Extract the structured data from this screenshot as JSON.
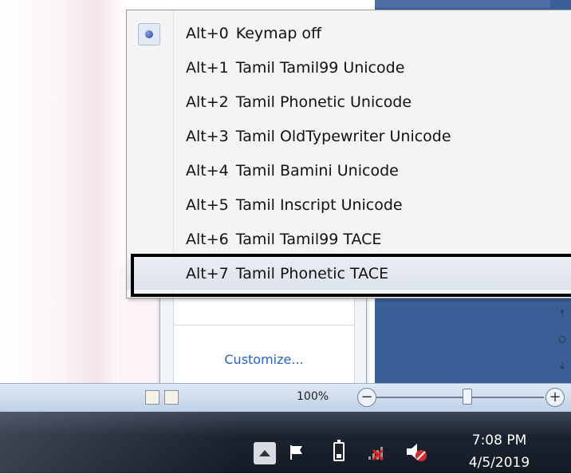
{
  "menu": {
    "items": [
      {
        "hotkey": "Alt+0",
        "label": "Keymap off",
        "checked": true
      },
      {
        "hotkey": "Alt+1",
        "label": "Tamil Tamil99 Unicode",
        "checked": false
      },
      {
        "hotkey": "Alt+2",
        "label": "Tamil Phonetic Unicode",
        "checked": false
      },
      {
        "hotkey": "Alt+3",
        "label": "Tamil OldTypewriter Unicode",
        "checked": false
      },
      {
        "hotkey": "Alt+4",
        "label": "Tamil Bamini Unicode",
        "checked": false
      },
      {
        "hotkey": "Alt+5",
        "label": "Tamil Inscript Unicode",
        "checked": false
      },
      {
        "hotkey": "Alt+6",
        "label": "Tamil Tamil99 TACE",
        "checked": false
      },
      {
        "hotkey": "Alt+7",
        "label": "Tamil Phonetic TACE",
        "checked": false
      }
    ],
    "highlighted_index": 7
  },
  "tray_popup": {
    "customize_label": "Customize..."
  },
  "statusbar": {
    "zoom_percent": "100%"
  },
  "taskbar": {
    "time": "7:08 PM",
    "date": "4/5/2019"
  },
  "colors": {
    "accent_blue": "#3a5f97",
    "link": "#1f63c6",
    "highlight_border": "#000000"
  }
}
